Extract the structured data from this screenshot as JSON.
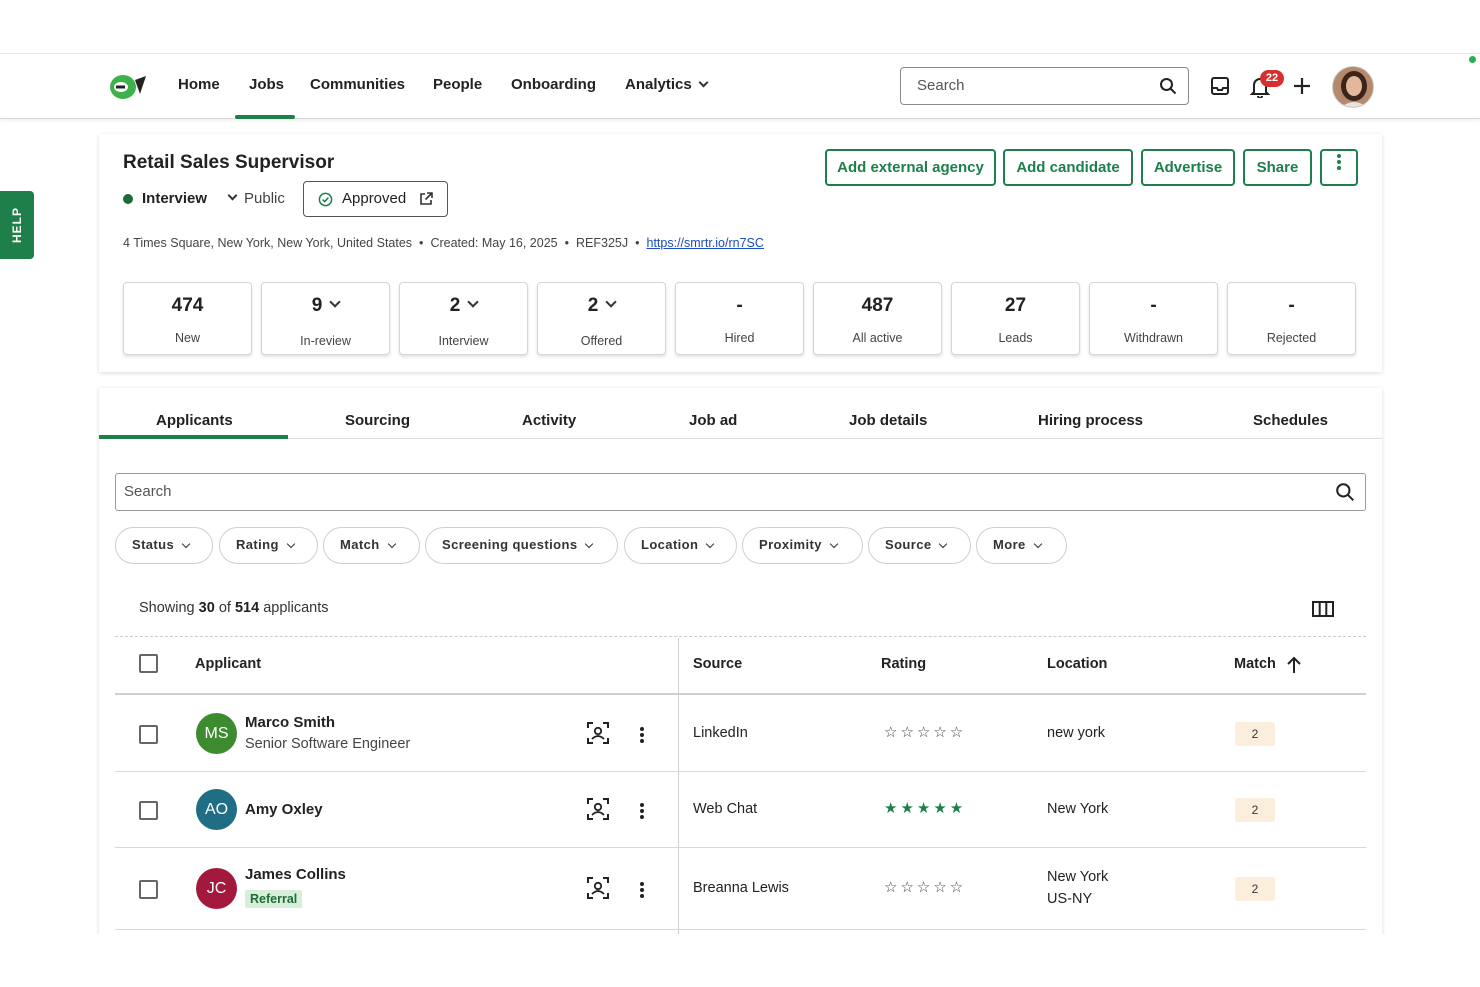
{
  "nav": {
    "items": [
      "Home",
      "Jobs",
      "Communities",
      "People",
      "Onboarding",
      "Analytics"
    ],
    "search_placeholder": "Search",
    "notification_count": "22"
  },
  "help": "HELP",
  "job": {
    "title": "Retail Sales Supervisor",
    "status": "Interview",
    "visibility": "Public",
    "approval": "Approved",
    "address": "4 Times Square, New York, New York, United States",
    "created": "Created: May 16, 2025",
    "ref": "REF325J",
    "link": "https://smrtr.io/rn7SC",
    "actions": [
      "Add external agency",
      "Add candidate",
      "Advertise",
      "Share"
    ],
    "stats": [
      {
        "value": "474",
        "label": "New"
      },
      {
        "value": "9",
        "label": "In-review"
      },
      {
        "value": "2",
        "label": "Interview"
      },
      {
        "value": "2",
        "label": "Offered"
      },
      {
        "value": "-",
        "label": "Hired"
      },
      {
        "value": "487",
        "label": "All active"
      },
      {
        "value": "27",
        "label": "Leads"
      },
      {
        "value": "-",
        "label": "Withdrawn"
      },
      {
        "value": "-",
        "label": "Rejected"
      }
    ]
  },
  "tabs": [
    "Applicants",
    "Sourcing",
    "Activity",
    "Job ad",
    "Job details",
    "Hiring process",
    "Schedules"
  ],
  "list": {
    "search_placeholder": "Search",
    "filters": [
      "Status",
      "Rating",
      "Match",
      "Screening questions",
      "Location",
      "Proximity",
      "Source",
      "More"
    ],
    "showing_prefix": "Showing",
    "showing_count": "30",
    "showing_of": "of",
    "showing_total": "514",
    "showing_suffix": "applicants",
    "columns": [
      "Applicant",
      "Source",
      "Rating",
      "Location",
      "Match"
    ],
    "rows": [
      {
        "initials": "MS",
        "color": "#3d8b2f",
        "name": "Marco Smith",
        "subtitle": "Senior Software Engineer",
        "source": "LinkedIn",
        "rating": 0,
        "location": "new york",
        "location2": "",
        "match": "2"
      },
      {
        "initials": "AO",
        "color": "#1f6e86",
        "name": "Amy Oxley",
        "subtitle": "",
        "source": "Web Chat",
        "rating": 5,
        "location": "New York",
        "location2": "",
        "match": "2"
      },
      {
        "initials": "JC",
        "color": "#a3193e",
        "name": "James Collins",
        "tag": "Referral",
        "source": "Breanna Lewis",
        "rating": 0,
        "location": "New York",
        "location2": "US-NY",
        "match": "2"
      }
    ]
  },
  "colors": {
    "brand_green": "#1e7f4a",
    "badge_red": "#d62f2f"
  }
}
